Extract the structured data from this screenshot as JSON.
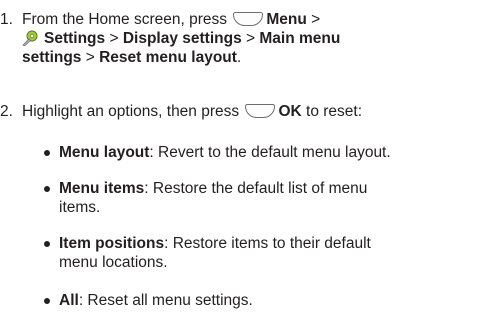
{
  "steps": [
    {
      "number": "1.",
      "intro": "From the Home screen, press",
      "key_label": "Menu",
      "sep1": " >",
      "settings_label": "Settings",
      "sep2": " > ",
      "display_settings": "Display settings",
      "sep3": " > ",
      "main_menu_settings_a": "Main menu",
      "main_menu_settings_b": "settings",
      "sep4": " > ",
      "reset_menu_layout": "Reset menu layout",
      "end": "."
    },
    {
      "number": "2.",
      "intro": "Highlight an options, then press",
      "key_label": "OK",
      "outro": " to reset:"
    }
  ],
  "options": [
    {
      "term": "Menu layout",
      "desc_1": ": Revert to the default menu layout.",
      "desc_2": ""
    },
    {
      "term": "Menu items",
      "desc_1": ": Restore the default list of menu",
      "desc_2": "items."
    },
    {
      "term": "Item positions",
      "desc_1": ": Restore items to their default",
      "desc_2": "menu locations."
    },
    {
      "term": "All",
      "desc_1": ": Reset all menu settings.",
      "desc_2": ""
    }
  ],
  "icons": {
    "soft_key": "soft-key-icon",
    "settings": "settings-gear-icon"
  },
  "colors": {
    "text": "#231f20",
    "key_border": "#6d6e71",
    "gear": "#8dc63f"
  }
}
